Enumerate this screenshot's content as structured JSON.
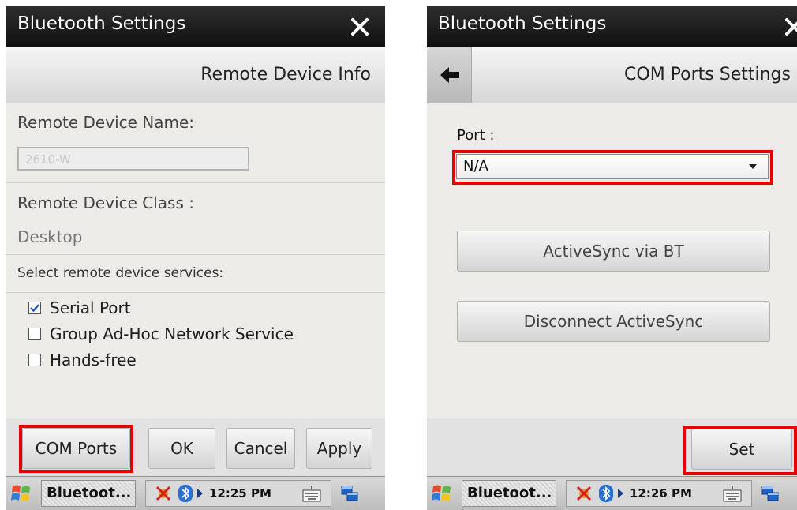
{
  "left": {
    "window_title": "Bluetooth Settings",
    "header_title": "Remote Device Info",
    "device_name_label": "Remote Device Name:",
    "device_name_value": "2610-W",
    "device_class_label": "Remote Device Class :",
    "device_class_value": "Desktop",
    "services_label": "Select remote device services:",
    "services": [
      {
        "label": "Serial Port",
        "checked": true
      },
      {
        "label": "Group Ad-Hoc Network Service",
        "checked": false
      },
      {
        "label": "Hands-free",
        "checked": false
      }
    ],
    "buttons": {
      "com_ports": "COM Ports",
      "ok": "OK",
      "cancel": "Cancel",
      "apply": "Apply"
    },
    "taskbar": {
      "app": "Bluetoot...",
      "time": "12:25 PM"
    }
  },
  "right": {
    "window_title": "Bluetooth Settings",
    "header_title": "COM Ports Settings",
    "port_label": "Port :",
    "port_value": "N/A",
    "activesync_button": "ActiveSync via BT",
    "disconnect_button": "Disconnect ActiveSync",
    "set_button": "Set",
    "taskbar": {
      "app": "Bluetoot...",
      "time": "12:26 PM"
    }
  },
  "colors": {
    "highlight": "#e60000",
    "titlebar": "#1a1a1a"
  },
  "icons": [
    "close-icon",
    "back-arrow-icon",
    "checkbox-checked-icon",
    "start-flag-icon",
    "bluetooth-icon",
    "keyboard-icon",
    "window-switch-icon"
  ]
}
